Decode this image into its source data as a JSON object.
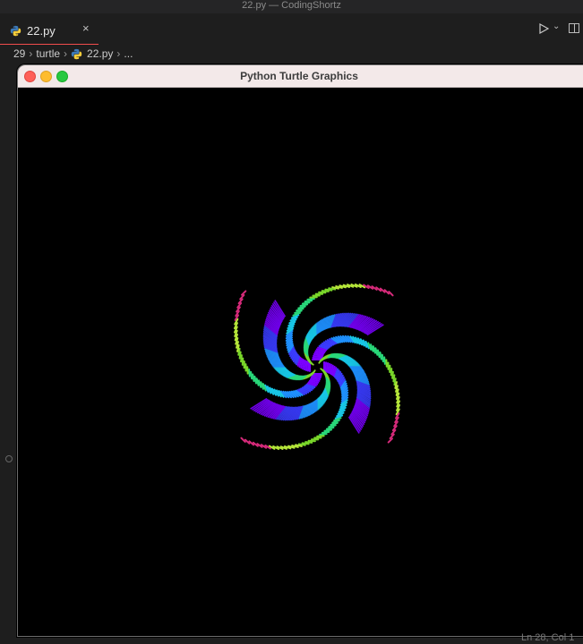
{
  "editor": {
    "window_title": "22.py — CodingShortz",
    "tab": {
      "label": "22.py",
      "close": "×"
    },
    "breadcrumb": [
      "29",
      "turtle",
      "22.py",
      "..."
    ],
    "status": "Ln 28, Col 1"
  },
  "turtle_window": {
    "title": "Python Turtle Graphics",
    "background": "#000000"
  },
  "colors": {
    "accent": "#f14c4c",
    "spiral": [
      "#7a00ff",
      "#3a3cff",
      "#1e90ff",
      "#18c8e8",
      "#29d97a",
      "#7ad82a",
      "#b7e83a",
      "#d62a7a"
    ]
  }
}
